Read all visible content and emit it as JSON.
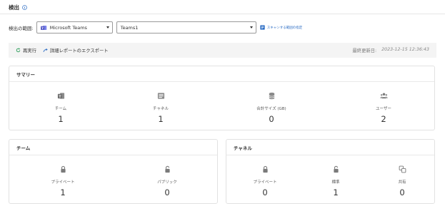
{
  "header": {
    "title": "検出"
  },
  "scope": {
    "label": "検出の範囲:",
    "service_value": "Microsoft Teams",
    "team_value": "Teams1",
    "scan_link": "スキャンする範囲の指定"
  },
  "actions": {
    "rerun": "再実行",
    "export": "詳細レポートのエクスポート",
    "last_updated_label": "最終更新日:",
    "last_updated_value": "2023-12-15 12:36:43"
  },
  "summary": {
    "title": "サマリー",
    "stats": [
      {
        "label": "チーム",
        "value": "1",
        "icon": "teams-icon"
      },
      {
        "label": "チャネル",
        "value": "1",
        "icon": "channel-icon"
      },
      {
        "label": "合計サイズ (GB)",
        "value": "0",
        "icon": "database-icon"
      },
      {
        "label": "ユーザー",
        "value": "2",
        "icon": "users-icon"
      }
    ]
  },
  "team_panel": {
    "title": "チーム",
    "stats": [
      {
        "label": "プライベート",
        "value": "1",
        "icon": "lock-icon"
      },
      {
        "label": "パブリック",
        "value": "0",
        "icon": "unlock-icon"
      }
    ]
  },
  "channel_panel": {
    "title": "チャネル",
    "stats": [
      {
        "label": "プライベート",
        "value": "0",
        "icon": "lock-icon"
      },
      {
        "label": "標準",
        "value": "1",
        "icon": "unlock-icon"
      },
      {
        "label": "共有",
        "value": "0",
        "icon": "shared-icon"
      }
    ]
  },
  "colors": {
    "accent": "#2b6cc4",
    "teams_purple": "#5b5fc7",
    "icon_gray": "#8a8a8a"
  }
}
